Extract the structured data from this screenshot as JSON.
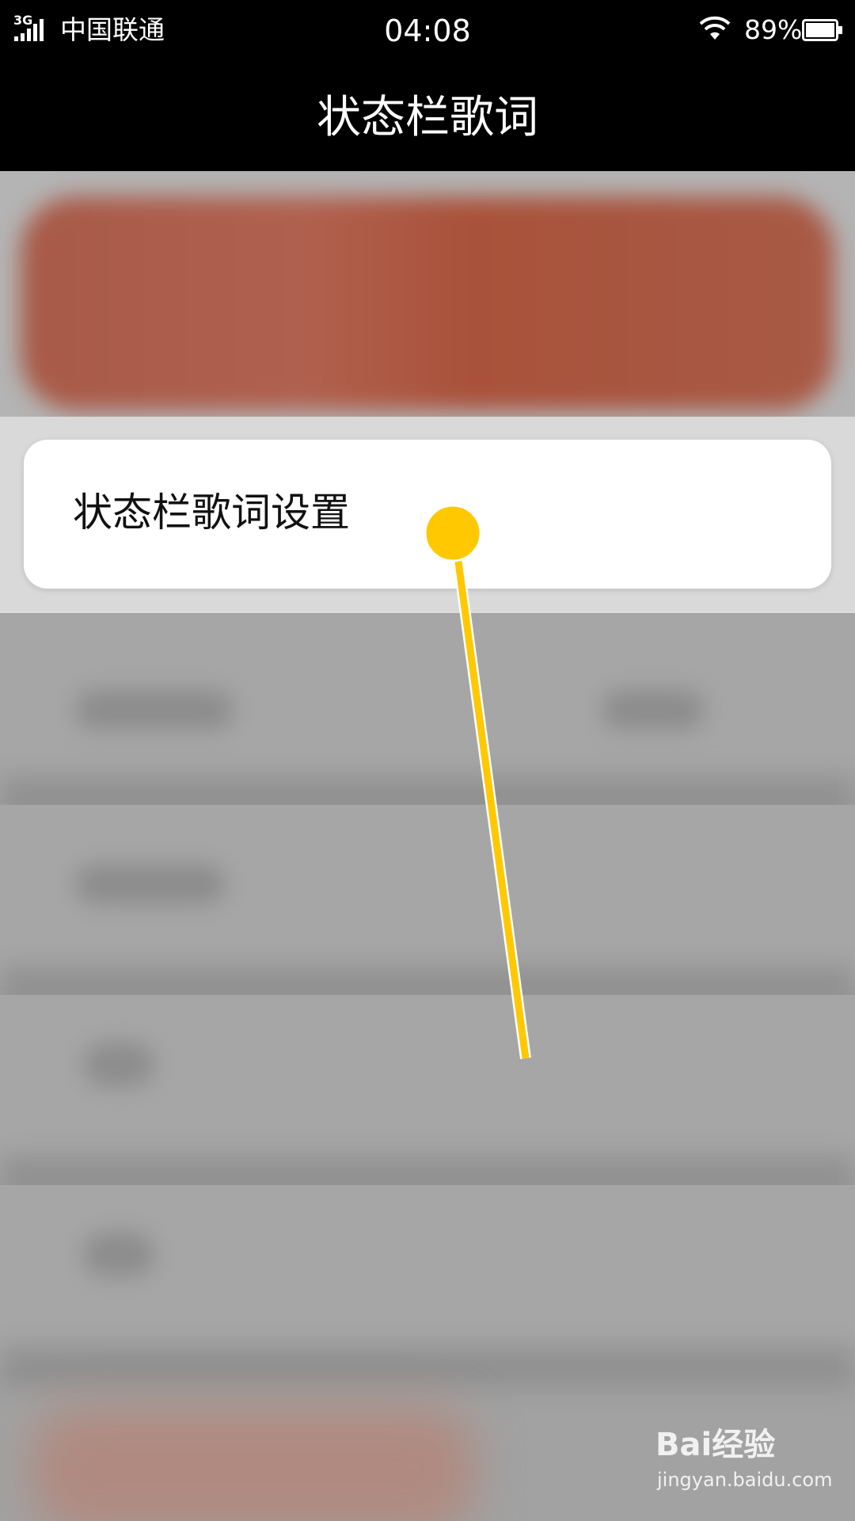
{
  "status_bar": {
    "network_type": "3G",
    "carrier": "中国联通",
    "time": "04:08",
    "battery_percent": "89%",
    "icons": [
      "signal-icon",
      "wifi-icon",
      "battery-icon"
    ]
  },
  "header": {
    "title": "状态栏歌词"
  },
  "menu": {
    "items": [
      {
        "label": "状态栏歌词设置"
      }
    ]
  },
  "annotation": {
    "pointer_color": "#ffc800"
  },
  "watermark": {
    "brand": "Bai经验",
    "url": "jingyan.baidu.com"
  }
}
